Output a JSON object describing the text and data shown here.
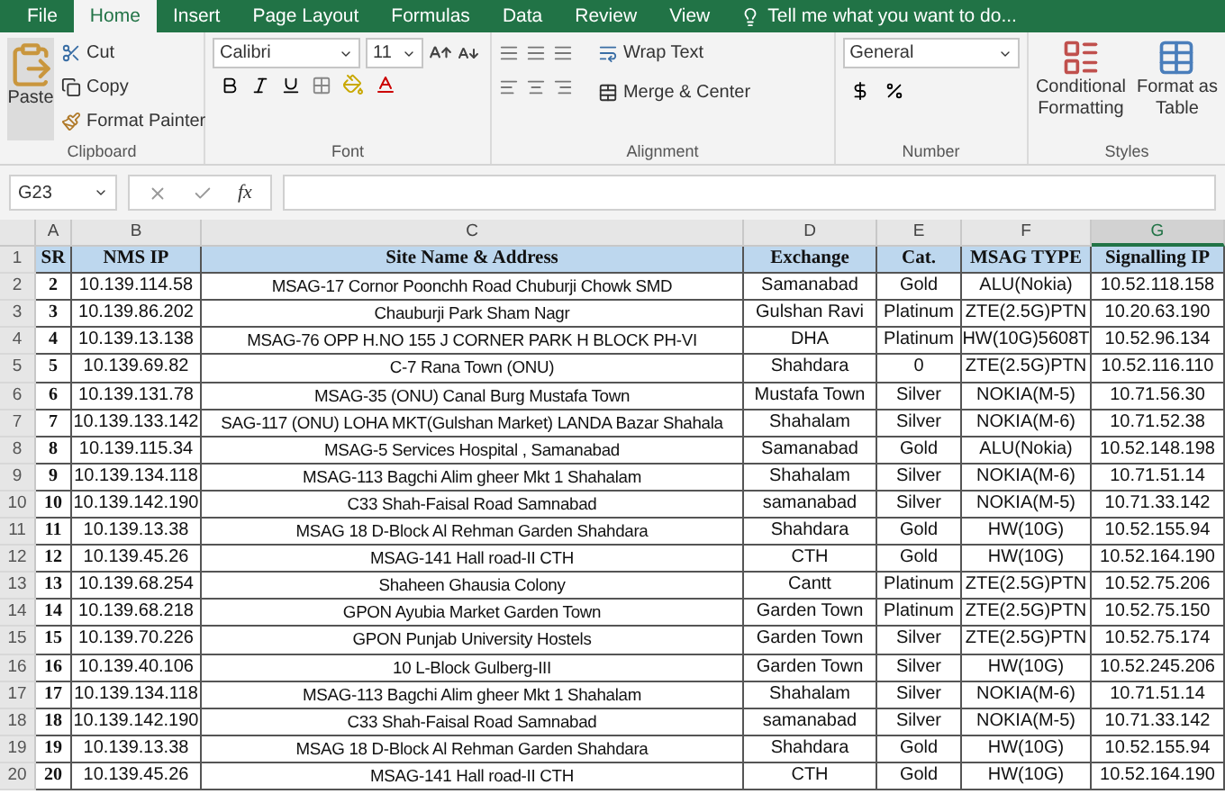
{
  "ribbon_tabs": [
    {
      "label": "File",
      "selected": false
    },
    {
      "label": "Home",
      "selected": true
    },
    {
      "label": "Insert",
      "selected": false
    },
    {
      "label": "Page Layout",
      "selected": false
    },
    {
      "label": "Formulas",
      "selected": false
    },
    {
      "label": "Data",
      "selected": false
    },
    {
      "label": "Review",
      "selected": false
    },
    {
      "label": "View",
      "selected": false
    }
  ],
  "tell_me": {
    "placeholder": "Tell me what you want to do..."
  },
  "clipboard": {
    "paste": "Paste",
    "cut": "Cut",
    "copy": "Copy",
    "format_painter": "Format Painter",
    "label": "Clipboard"
  },
  "font": {
    "name": "Calibri",
    "size": "11",
    "label": "Font"
  },
  "alignment": {
    "wrap_text": "Wrap Text",
    "merge_center": "Merge & Center",
    "label": "Alignment"
  },
  "number": {
    "format": "General",
    "label": "Number"
  },
  "styles": {
    "conditional_formatting": [
      "Conditional",
      "Formatting"
    ],
    "format_as_table": [
      "Format as",
      "Table"
    ],
    "label": "Styles"
  },
  "formula_bar": {
    "name_box": "G23",
    "function_label": "fx"
  },
  "columns": [
    {
      "letter": "A",
      "selected": false
    },
    {
      "letter": "B",
      "selected": false
    },
    {
      "letter": "C",
      "selected": false
    },
    {
      "letter": "D",
      "selected": false
    },
    {
      "letter": "E",
      "selected": false
    },
    {
      "letter": "F",
      "selected": false
    },
    {
      "letter": "G",
      "selected": true
    }
  ],
  "rows": [
    {
      "number": "1",
      "kind": "header",
      "cells": [
        "SR",
        "NMS IP",
        "Site Name & Address",
        "Exchange",
        "Cat.",
        "MSAG TYPE",
        "Signalling IP"
      ]
    },
    {
      "number": "2",
      "kind": "data",
      "cells": [
        "2",
        "10.139.114.58",
        "MSAG-17 Cornor Poonchh Road Chuburji Chowk SMD",
        "Samanabad",
        "Gold",
        "ALU(Nokia)",
        "10.52.118.158"
      ]
    },
    {
      "number": "3",
      "kind": "data",
      "cells": [
        "3",
        "10.139.86.202",
        "Chauburji Park Sham Nagr",
        "Gulshan Ravi",
        "Platinum",
        "ZTE(2.5G)PTN",
        "10.20.63.190"
      ]
    },
    {
      "number": "4",
      "kind": "data",
      "cells": [
        "4",
        "10.139.13.138",
        "MSAG-76 OPP H.NO 155 J CORNER PARK H BLOCK PH-VI",
        "DHA",
        "Platinum",
        "HW(10G)5608T",
        "10.52.96.134"
      ]
    },
    {
      "number": "5",
      "kind": "data",
      "cells": [
        "5",
        "10.139.69.82",
        "C-7 Rana Town (ONU)",
        "Shahdara",
        "0",
        "ZTE(2.5G)PTN",
        "10.52.116.110"
      ]
    },
    {
      "number": "6",
      "kind": "data",
      "cells": [
        "6",
        "10.139.131.78",
        "MSAG-35 (ONU) Canal Burg Mustafa Town",
        "Mustafa Town",
        "Silver",
        "NOKIA(M-5)",
        "10.71.56.30"
      ]
    },
    {
      "number": "7",
      "kind": "data",
      "cells": [
        "7",
        "10.139.133.142",
        "SAG-117 (ONU)  LOHA MKT(Gulshan Market) LANDA Bazar Shahala",
        "Shahalam",
        "Silver",
        "NOKIA(M-6)",
        "10.71.52.38"
      ]
    },
    {
      "number": "8",
      "kind": "data",
      "cells": [
        "8",
        "10.139.115.34",
        "MSAG-5 Services Hospital , Samanabad",
        "Samanabad",
        "Gold",
        "ALU(Nokia)",
        "10.52.148.198"
      ]
    },
    {
      "number": "9",
      "kind": "data",
      "cells": [
        "9",
        "10.139.134.118",
        "MSAG-113 Bagchi Alim gheer Mkt 1 Shahalam",
        "Shahalam",
        "Silver",
        "NOKIA(M-6)",
        "10.71.51.14"
      ]
    },
    {
      "number": "10",
      "kind": "data",
      "cells": [
        "10",
        "10.139.142.190",
        "C33 Shah-Faisal Road Samnabad",
        "samanabad",
        "Silver",
        "NOKIA(M-5)",
        "10.71.33.142"
      ]
    },
    {
      "number": "11",
      "kind": "data",
      "cells": [
        "11",
        "10.139.13.38",
        "MSAG 18 D-Block Al Rehman Garden Shahdara",
        "Shahdara",
        "Gold",
        "HW(10G)",
        "10.52.155.94"
      ]
    },
    {
      "number": "12",
      "kind": "data",
      "cells": [
        "12",
        "10.139.45.26",
        "MSAG-141 Hall road-II CTH",
        "CTH",
        "Gold",
        "HW(10G)",
        "10.52.164.190"
      ]
    },
    {
      "number": "13",
      "kind": "data",
      "cells": [
        "13",
        "10.139.68.254",
        "Shaheen Ghausia Colony",
        "Cantt",
        "Platinum",
        "ZTE(2.5G)PTN",
        "10.52.75.206"
      ]
    },
    {
      "number": "14",
      "kind": "data",
      "cells": [
        "14",
        "10.139.68.218",
        "GPON Ayubia Market Garden Town",
        "Garden Town",
        "Platinum",
        "ZTE(2.5G)PTN",
        "10.52.75.150"
      ]
    },
    {
      "number": "15",
      "kind": "data",
      "cells": [
        "15",
        "10.139.70.226",
        "GPON Punjab University Hostels",
        "Garden Town",
        "Silver",
        "ZTE(2.5G)PTN",
        "10.52.75.174"
      ]
    },
    {
      "number": "16",
      "kind": "data",
      "cells": [
        "16",
        "10.139.40.106",
        "10 L-Block Gulberg-III",
        "Garden Town",
        "Silver",
        "HW(10G)",
        "10.52.245.206"
      ]
    },
    {
      "number": "17",
      "kind": "data",
      "cells": [
        "17",
        "10.139.134.118",
        "MSAG-113 Bagchi Alim gheer Mkt 1 Shahalam",
        "Shahalam",
        "Silver",
        "NOKIA(M-6)",
        "10.71.51.14"
      ]
    },
    {
      "number": "18",
      "kind": "data",
      "cells": [
        "18",
        "10.139.142.190",
        "C33 Shah-Faisal Road Samnabad",
        "samanabad",
        "Silver",
        "NOKIA(M-5)",
        "10.71.33.142"
      ]
    },
    {
      "number": "19",
      "kind": "data",
      "cells": [
        "19",
        "10.139.13.38",
        "MSAG 18 D-Block Al Rehman Garden Shahdara",
        "Shahdara",
        "Gold",
        "HW(10G)",
        "10.52.155.94"
      ]
    },
    {
      "number": "20",
      "kind": "data",
      "cells": [
        "20",
        "10.139.45.26",
        "MSAG-141 Hall road-II CTH",
        "CTH",
        "Gold",
        "HW(10G)",
        "10.52.164.190"
      ]
    }
  ]
}
